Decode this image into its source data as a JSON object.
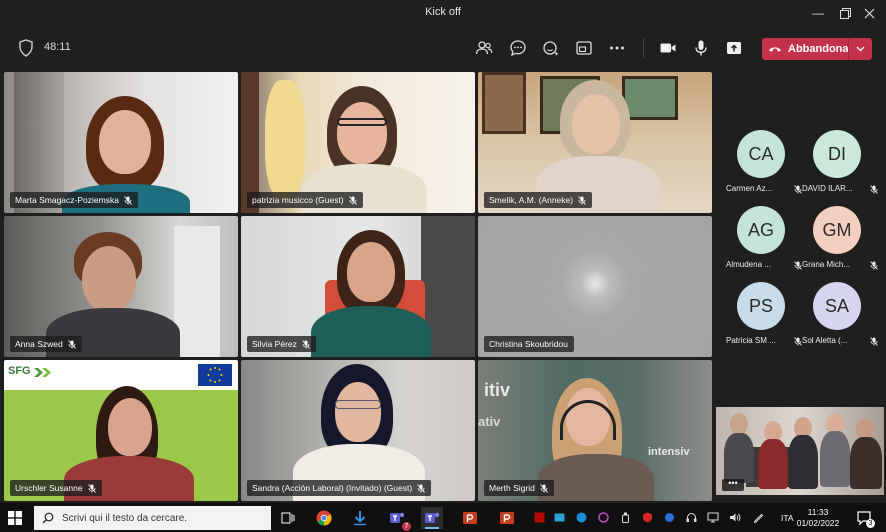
{
  "window": {
    "title": "Kick off"
  },
  "toolbar": {
    "timer": "48:11",
    "leave_label": "Abbandona",
    "icons": [
      "participants-icon",
      "chat-icon",
      "reactions-icon",
      "rooms-icon",
      "more-icon",
      "camera-icon",
      "mic-icon",
      "share-icon"
    ]
  },
  "colors": {
    "leave": "#c4314b",
    "background": "#1f1f1f",
    "taskbar": "#101010"
  },
  "tiles": [
    {
      "name": "Marta Smagacz-Poziemska"
    },
    {
      "name": "patrizia musicco (Guest)"
    },
    {
      "name": "Smelik, A.M. (Anneke)"
    },
    {
      "name": "Anna Szwed"
    },
    {
      "name": "Silvia Pérez"
    },
    {
      "name": "Christina Skoubridou"
    },
    {
      "name": "Urschler Susanne",
      "banner_text": "SFG"
    },
    {
      "name": "Sandra (Acción Laboral) (Invitado) (Guest)"
    },
    {
      "name": "Merth Sigrid",
      "wall_text_1": "itiv",
      "wall_text_2": "ativ",
      "wall_text_3": "intensiv"
    }
  ],
  "attendees": [
    {
      "initials": "CA",
      "name": "Carmen Az...",
      "color": "#c6e3d9"
    },
    {
      "initials": "DI",
      "name": "DAVID ILAR...",
      "color": "#cce8d8"
    },
    {
      "initials": "AG",
      "name": "Almudena ...",
      "color": "#c6e3d9"
    },
    {
      "initials": "GM",
      "name": "Grana Mich...",
      "color": "#f3cfc2"
    },
    {
      "initials": "PS",
      "name": "Patricia SM ...",
      "color": "#c7dbe8"
    },
    {
      "initials": "SA",
      "name": "Sol Aletta (...",
      "color": "#d6d5ee"
    }
  ],
  "selfview": {
    "more_label": "•••"
  },
  "taskbar": {
    "search_placeholder": "Scrivi qui il testo da cercare.",
    "teams_badge": "7",
    "lang": "ITA",
    "time": "11:33",
    "date": "01/02/2022",
    "notification_count": "3"
  }
}
